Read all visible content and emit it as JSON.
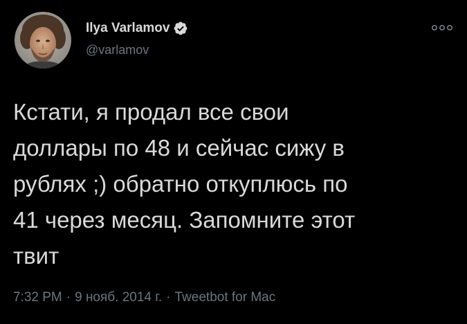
{
  "author": {
    "display_name": "Ilya Varlamov",
    "handle": "@varlamov",
    "verified": true
  },
  "more_icon": "more-dots-icon",
  "tweet": {
    "text": "Кстати, я продал все свои\nдоллары по 48 и сейчас сижу в\nрублях ;) обратно откуплюсь по\n41 через месяц. Запомните этот\nтвит"
  },
  "meta": {
    "time": "7:32 PM",
    "date": "9 нояб. 2014 г.",
    "client": "Tweetbot for Mac",
    "separator": "·"
  },
  "colors": {
    "background": "#000000",
    "text": "#d9d9d9",
    "secondary": "#6e767d",
    "verified_badge": "#d9d9d9"
  }
}
